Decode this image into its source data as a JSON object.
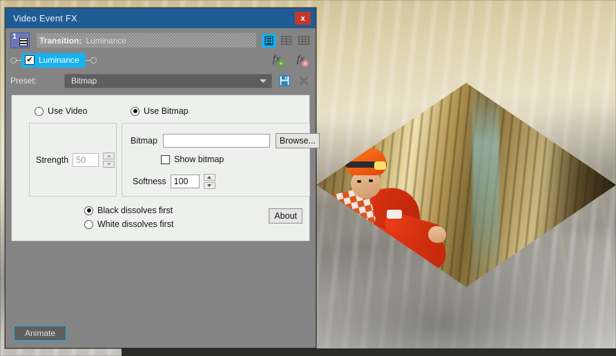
{
  "window": {
    "title": "Video Event FX",
    "close_label": "x",
    "close_icon": "close-icon"
  },
  "chain": {
    "track_number": "1",
    "film_icon": "film-strip-icon",
    "transition_label": "Transition:",
    "transition_value": "Luminance",
    "layout_buttons": [
      {
        "icon": "single-column-layout-icon",
        "active": true
      },
      {
        "icon": "two-column-layout-icon",
        "active": false
      },
      {
        "icon": "three-column-layout-icon",
        "active": false
      }
    ],
    "plugin": {
      "name": "Luminance",
      "enabled": true,
      "check_glyph": "✔"
    },
    "fx_buttons": [
      {
        "icon": "add-plugin-icon",
        "glyph": "fx",
        "badge": "+"
      },
      {
        "icon": "remove-plugin-icon",
        "glyph": "fx",
        "badge": "×"
      }
    ]
  },
  "preset": {
    "label": "Preset:",
    "value": "Bitmap",
    "save_icon": "save-preset-icon",
    "delete_icon": "delete-preset-icon"
  },
  "panel": {
    "source_mode": {
      "use_video": {
        "label": "Use Video",
        "selected": false
      },
      "use_bitmap": {
        "label": "Use Bitmap",
        "selected": true
      }
    },
    "video_group": {
      "strength_label": "Strength",
      "strength_value": "50",
      "strength_enabled": false
    },
    "bitmap_group": {
      "bitmap_label": "Bitmap",
      "bitmap_value": "",
      "bitmap_placeholder": "",
      "browse_label": "Browse...",
      "show_bitmap_label": "Show bitmap",
      "show_bitmap_checked": false,
      "softness_label": "Softness",
      "softness_value": "100"
    },
    "dissolve_order": {
      "black_first": {
        "label": "Black dissolves first",
        "selected": true
      },
      "white_first": {
        "label": "White dissolves first",
        "selected": false
      }
    },
    "about_label": "About"
  },
  "footer": {
    "animate_label": "Animate"
  },
  "colors": {
    "titlebar": "#1f5c96",
    "accent": "#17b1ed",
    "close": "#c0392f",
    "dialog_bg": "#848484",
    "panel_bg": "#eef0ee"
  }
}
